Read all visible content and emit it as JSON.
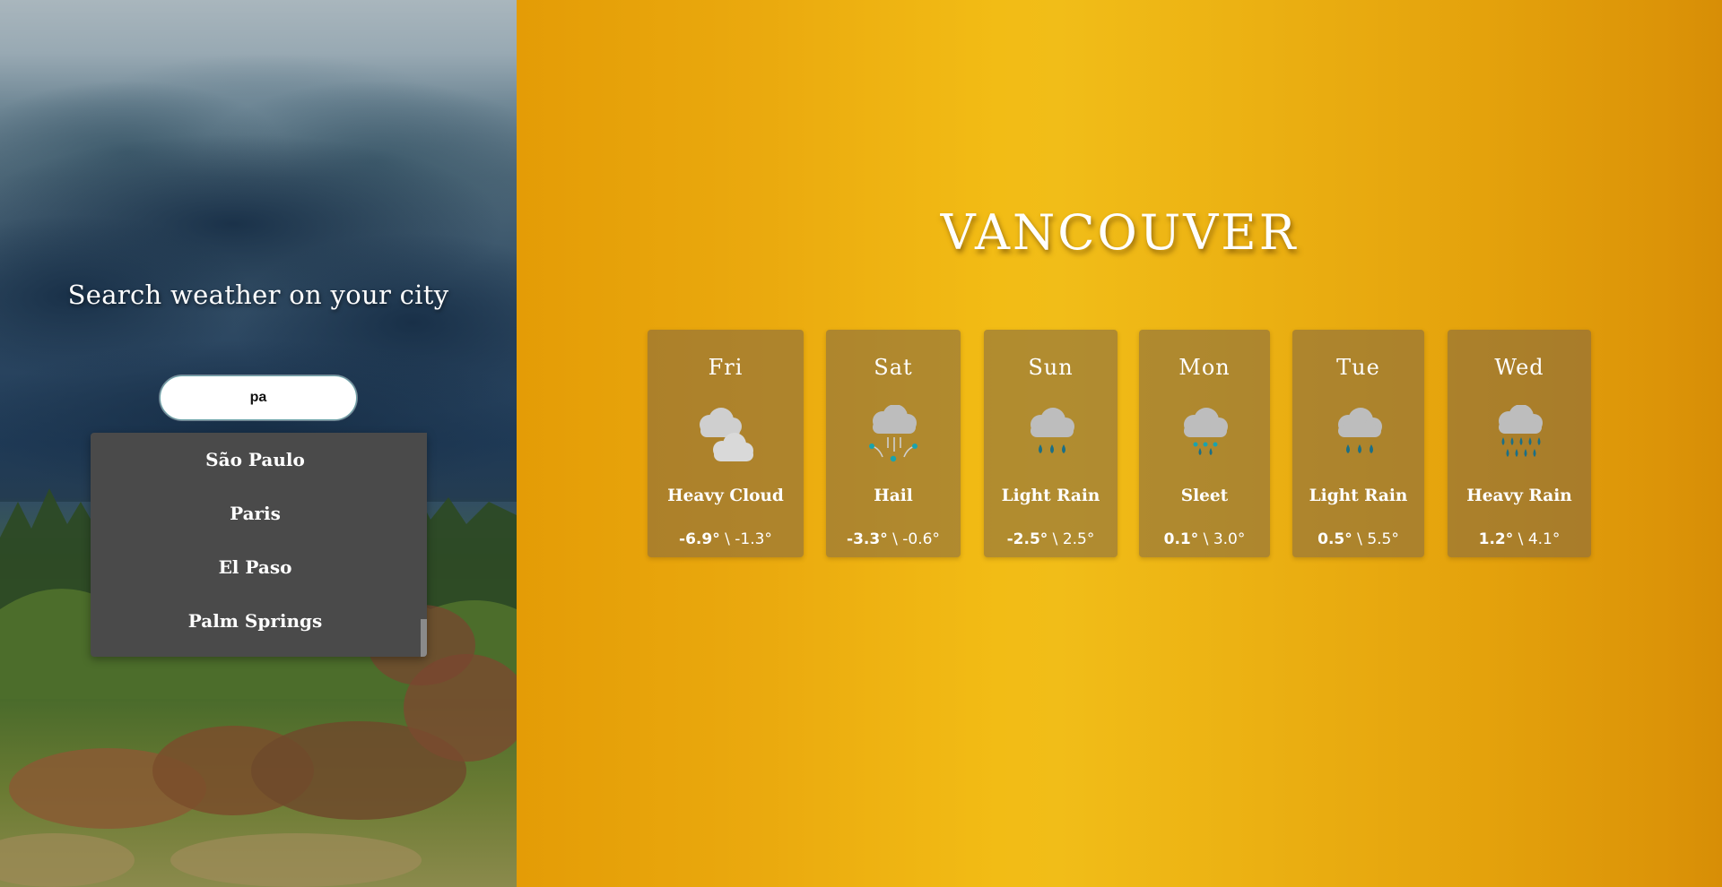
{
  "search": {
    "title": "Search weather on your city",
    "query": "pa",
    "suggestions": [
      "São Paulo",
      "Paris",
      "El Paso",
      "Palm Springs"
    ]
  },
  "location": {
    "city": "VANCOUVER"
  },
  "forecast": [
    {
      "day": "Fri",
      "condition": "Heavy Cloud",
      "icon": "heavy-cloud-icon",
      "min": "-6.9°",
      "sep": " \\ ",
      "max": "-1.3°"
    },
    {
      "day": "Sat",
      "condition": "Hail",
      "icon": "hail-icon",
      "min": "-3.3°",
      "sep": " \\ ",
      "max": "-0.6°"
    },
    {
      "day": "Sun",
      "condition": "Light Rain",
      "icon": "light-rain-icon",
      "min": "-2.5°",
      "sep": " \\ ",
      "max": "2.5°"
    },
    {
      "day": "Mon",
      "condition": "Sleet",
      "icon": "sleet-icon",
      "min": "0.1°",
      "sep": " \\ ",
      "max": "3.0°"
    },
    {
      "day": "Tue",
      "condition": "Light Rain",
      "icon": "light-rain-icon",
      "min": "0.5°",
      "sep": " \\ ",
      "max": "5.5°"
    },
    {
      "day": "Wed",
      "condition": "Heavy Rain",
      "icon": "heavy-rain-icon",
      "min": "1.2°",
      "sep": " \\ ",
      "max": "4.1°"
    }
  ],
  "colors": {
    "accent": "#f2bc15",
    "card": "#7c6446",
    "dropdown": "#4a4a4a",
    "cloud": "#c9c9c9",
    "rain": "#1b6f86",
    "sleet": "#1aa3ad"
  }
}
